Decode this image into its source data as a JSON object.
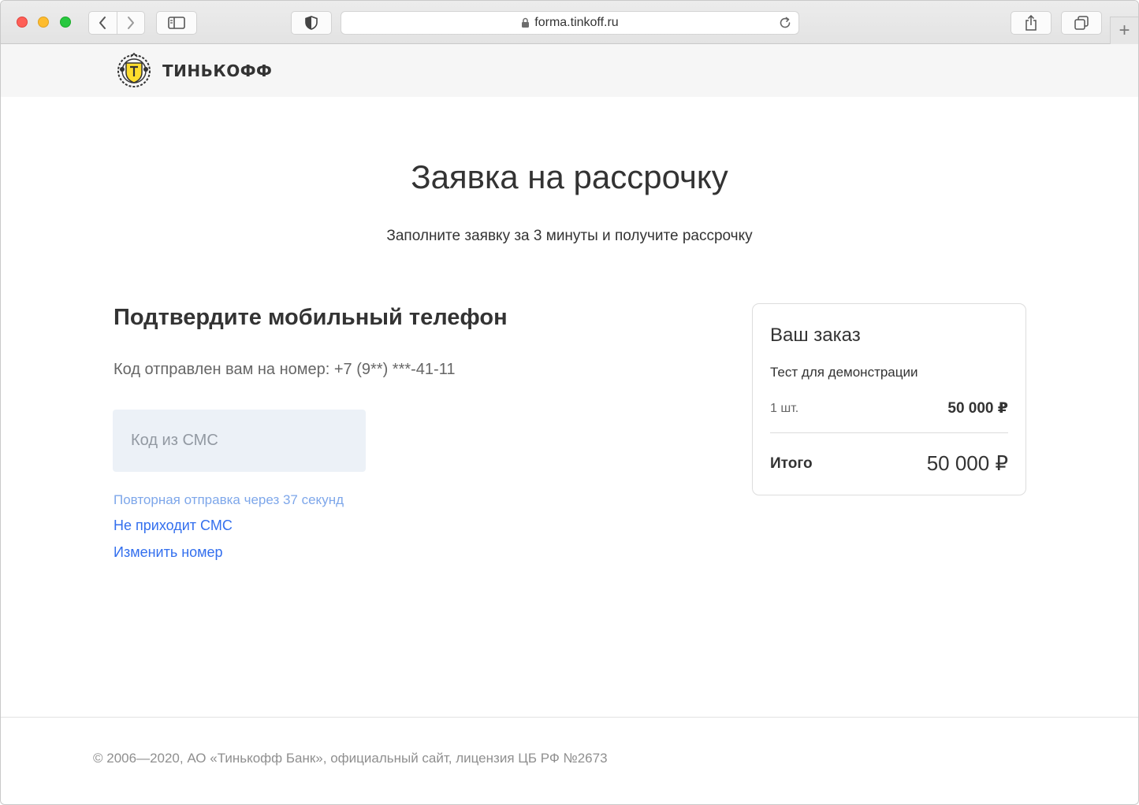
{
  "browser": {
    "url": "forma.tinkoff.ru",
    "new_tab_glyph": "+"
  },
  "header": {
    "logo_text": "ТИНЬКОФФ"
  },
  "main": {
    "title": "Заявка на рассрочку",
    "subtitle": "Заполните заявку за 3 минуты и получите рассрочку"
  },
  "phone_confirm": {
    "title": "Подтвердите мобильный телефон",
    "code_sent": "Код отправлен вам на номер: +7 (9**) ***-41-11",
    "sms_placeholder": "Код из СМС",
    "sms_value": "",
    "resend_text": "Повторная отправка через 37 секунд",
    "no_sms_link": "Не приходит СМС",
    "change_number_link": "Изменить номер"
  },
  "order": {
    "title": "Ваш заказ",
    "item_name": "Тест для демонстрации",
    "quantity": "1 шт.",
    "price": "50 000 ₽",
    "total_label": "Итого",
    "total_value": "50 000 ₽"
  },
  "footer": {
    "copyright": "© 2006—2020, АО «Тинькофф Банк», официальный сайт, лицензия ЦБ РФ №2673"
  },
  "colors": {
    "link": "#336fee",
    "resend": "#7ea7ea",
    "input_bg": "#ecf1f7",
    "brand_yellow": "#ffdd2d"
  }
}
